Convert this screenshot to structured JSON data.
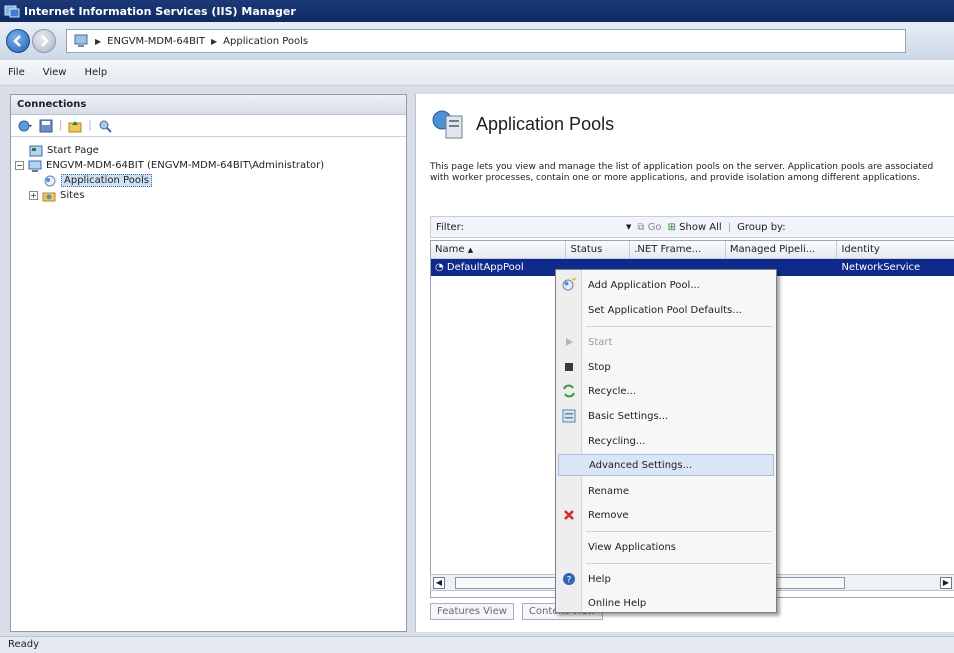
{
  "window": {
    "title": "Internet Information Services (IIS) Manager"
  },
  "address": {
    "crumbs": [
      "ENGVM-MDM-64BIT",
      "Application Pools"
    ]
  },
  "menu": {
    "file": "File",
    "view": "View",
    "help": "Help"
  },
  "connections": {
    "title": "Connections",
    "tree": {
      "start_page": "Start Page",
      "server": "ENGVM-MDM-64BIT (ENGVM-MDM-64BIT\\Administrator)",
      "app_pools": "Application Pools",
      "sites": "Sites"
    }
  },
  "content": {
    "title": "Application Pools",
    "description": "This page lets you view and manage the list of application pools on the server. Application pools are associated with worker processes, contain one or more applications, and provide isolation among different applications.",
    "filter_label": "Filter:",
    "go_label": "Go",
    "show_all_label": "Show All",
    "group_by_label": "Group by:",
    "columns": [
      "Name",
      "Status",
      ".NET Frame...",
      "Managed Pipeli...",
      "Identity"
    ],
    "rows": [
      {
        "name": "DefaultAppPool",
        "identity": "NetworkService"
      }
    ],
    "features_view_tab": "Features View",
    "content_view_tab": "Content View"
  },
  "context_menu": {
    "items": [
      {
        "label": "Add Application Pool...",
        "icon": "add-pool-icon",
        "enabled": true
      },
      {
        "label": "Set Application Pool Defaults...",
        "icon": "",
        "enabled": true
      },
      {
        "label": "Start",
        "icon": "start-icon",
        "enabled": false
      },
      {
        "label": "Stop",
        "icon": "stop-icon",
        "enabled": true
      },
      {
        "label": "Recycle...",
        "icon": "recycle-icon",
        "enabled": true
      },
      {
        "label": "Basic Settings...",
        "icon": "settings-icon",
        "enabled": true
      },
      {
        "label": "Recycling...",
        "icon": "",
        "enabled": true
      },
      {
        "label": "Advanced Settings...",
        "icon": "",
        "enabled": true,
        "highlighted": true
      },
      {
        "label": "Rename",
        "icon": "",
        "enabled": true
      },
      {
        "label": "Remove",
        "icon": "remove-icon",
        "enabled": true
      },
      {
        "label": "View Applications",
        "icon": "",
        "enabled": true
      },
      {
        "label": "Help",
        "icon": "help-icon",
        "enabled": true
      },
      {
        "label": "Online Help",
        "icon": "",
        "enabled": true
      }
    ]
  },
  "status": {
    "text": "Ready"
  },
  "colors": {
    "selection": "#0f2a8a",
    "titlebar": "#1c3a78",
    "menu_highlight": "#dbe5f5"
  }
}
